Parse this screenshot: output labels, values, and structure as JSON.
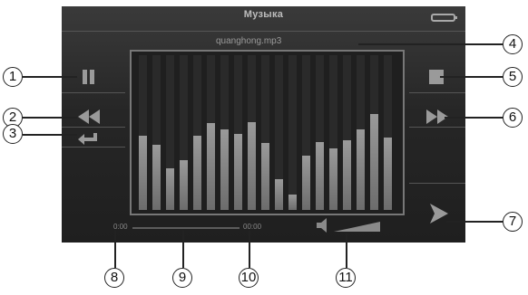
{
  "screen": {
    "title": "Музыка",
    "file_name": "quanghong.mp3",
    "time": {
      "elapsed": "0:00",
      "total": "00:00"
    },
    "volume_level": 0.75,
    "progress_fraction": 0.0,
    "eq_levels": [
      0.48,
      0.42,
      0.27,
      0.32,
      0.48,
      0.56,
      0.52,
      0.49,
      0.57,
      0.43,
      0.2,
      0.1,
      0.35,
      0.44,
      0.4,
      0.45,
      0.52,
      0.62,
      0.47
    ],
    "colors": {
      "background": "#262626",
      "controls": "#9a9a9a",
      "text": "#bdbdbd"
    }
  },
  "icons": {
    "pause": "pause-icon",
    "previous": "previous-icon",
    "repeat": "repeat-icon",
    "stop": "stop-icon",
    "next": "next-icon",
    "play": "play-icon",
    "volume": "volume-icon",
    "battery": "battery-icon"
  },
  "callouts": [
    "1",
    "2",
    "3",
    "4",
    "5",
    "6",
    "7",
    "8",
    "9",
    "10",
    "11"
  ]
}
